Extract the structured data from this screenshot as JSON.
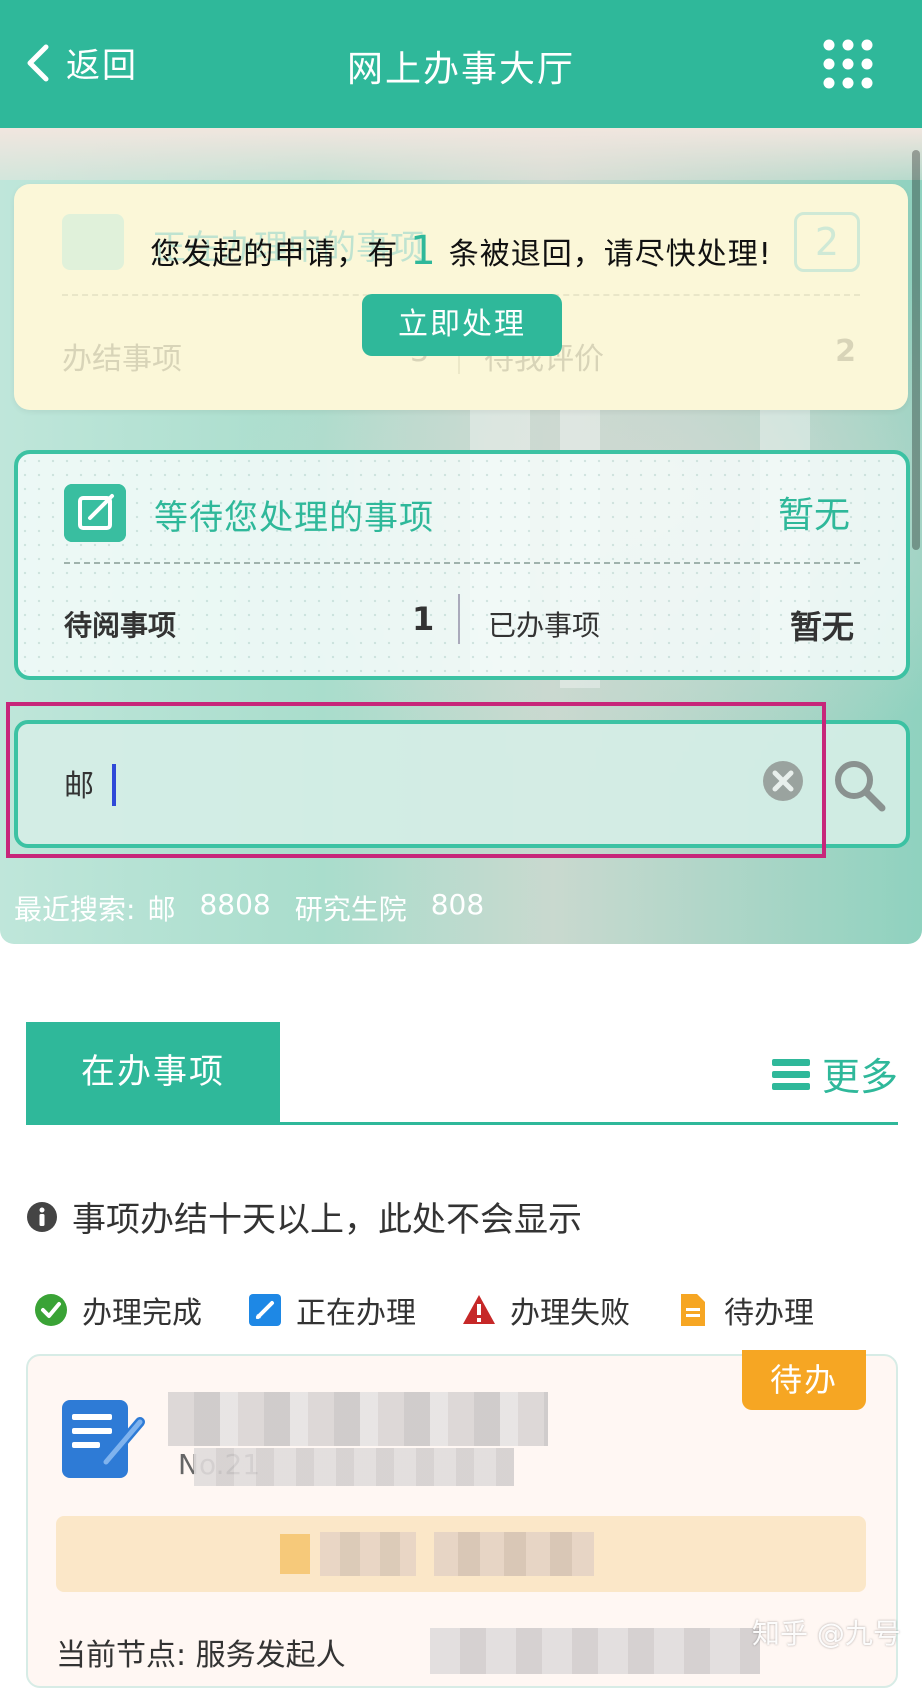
{
  "header": {
    "back_label": "返回",
    "title": "网上办事大厅"
  },
  "notice": {
    "ghost_title": "正在办理中的事项",
    "ghost_count": "2",
    "ghost_left_label": "办结事项",
    "ghost_left_value": "3",
    "ghost_right_label": "待我评价",
    "ghost_right_value": "2",
    "message_prefix": "您发起的申请，有",
    "message_count": "1",
    "message_suffix": "条被退回，请尽快处理!",
    "button_label": "立即处理"
  },
  "pending": {
    "title": "等待您处理的事项",
    "status": "暂无",
    "to_read_label": "待阅事项",
    "to_read_count": "1",
    "done_label": "已办事项",
    "done_value": "暂无"
  },
  "search": {
    "value": "邮",
    "recent_label": "最近搜索:",
    "recent_items": [
      "邮",
      "8808",
      "研究生院",
      "808"
    ]
  },
  "tabs": {
    "active_label": "在办事项",
    "more_label": "更多"
  },
  "hint": "事项办结十天以上，此处不会显示",
  "legend": [
    {
      "label": "办理完成",
      "icon": "check-circle-icon",
      "color": "#3aa336"
    },
    {
      "label": "正在办理",
      "icon": "pencil-square-icon",
      "color": "#1e88e5"
    },
    {
      "label": "办理失败",
      "icon": "warning-triangle-icon",
      "color": "#c62828"
    },
    {
      "label": "待办理",
      "icon": "document-icon",
      "color": "#f6a623"
    }
  ],
  "task": {
    "badge": "待办",
    "no_prefix": "No.21",
    "current_node": "当前节点: 服务发起人"
  },
  "watermark": "知乎 @九号",
  "colors": {
    "brand": "#2fb89a",
    "highlight": "#c7267a",
    "badge": "#f6a623"
  }
}
